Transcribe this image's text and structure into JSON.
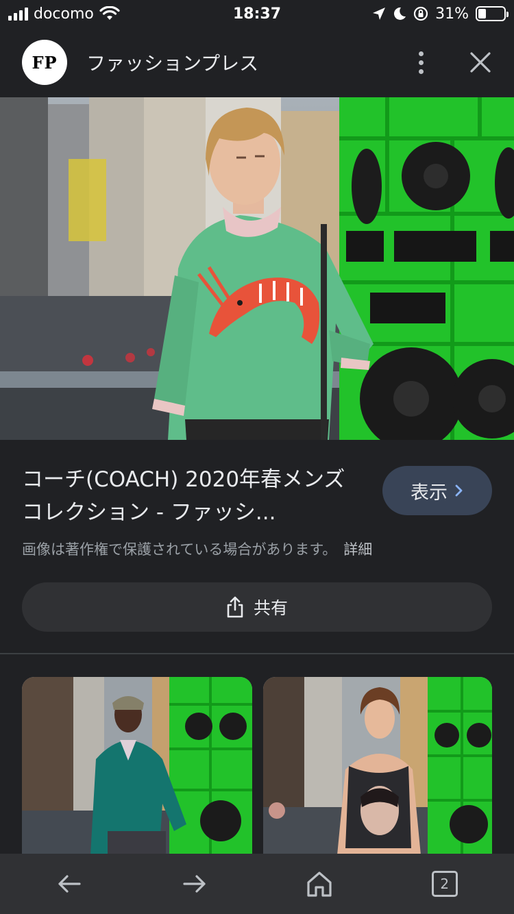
{
  "status_bar": {
    "carrier": "docomo",
    "time": "18:37",
    "battery_percent": "31%",
    "battery_level": 0.31
  },
  "header": {
    "logo_text": "FP",
    "site_name": "ファッションプレス"
  },
  "result": {
    "title": "コーチ(COACH) 2020年春メンズコレクション - ファッシ...",
    "view_button_label": "表示",
    "copyright_notice": "画像は著作権で保護されている場合があります。",
    "details_link": "詳細",
    "share_button_label": "共有"
  },
  "bottom_nav": {
    "tab_count": "2"
  },
  "colors": {
    "background": "#202124",
    "view_button_bg": "#394457",
    "accent_blue": "#8ab4f8",
    "speaker_green": "#22c22a",
    "sweater_green": "#5fbd8a",
    "shrimp_orange": "#e8533a"
  },
  "icons": [
    "signal-icon",
    "wifi-icon",
    "location-icon",
    "moon-icon",
    "orientation-lock-icon",
    "battery-icon",
    "more-vert-icon",
    "close-icon",
    "chevron-right-icon",
    "share-icon",
    "back-arrow-icon",
    "forward-arrow-icon",
    "home-icon",
    "tabs-icon"
  ]
}
